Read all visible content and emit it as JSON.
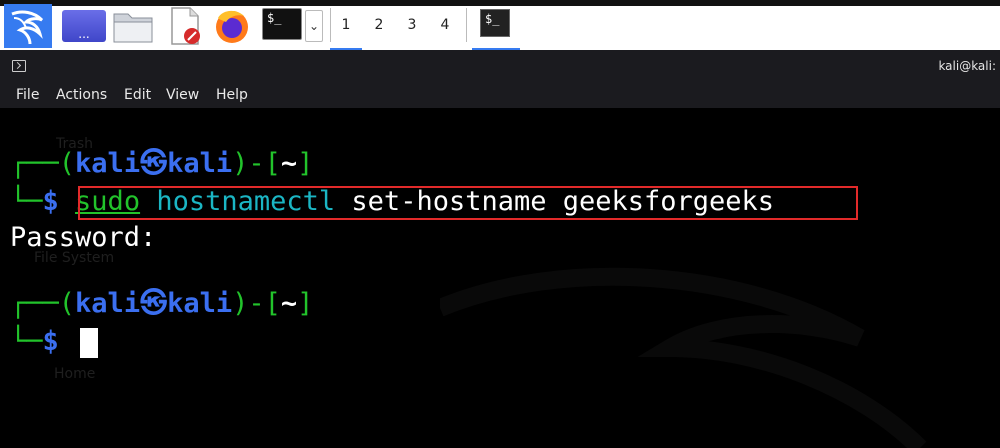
{
  "taskbar": {
    "workspaces": [
      "1",
      "2",
      "3",
      "4"
    ],
    "active_workspace": "1",
    "desk_switch_dots": "...",
    "term_icon_text": "$_",
    "dropdown_glyph": "⌄"
  },
  "window": {
    "title": "kali@kali:"
  },
  "menu": {
    "items": [
      "File",
      "Actions",
      "Edit",
      "View",
      "Help"
    ]
  },
  "desktop": {
    "labels": [
      "Trash",
      "File System",
      "Home"
    ]
  },
  "terminal": {
    "prompt1": {
      "corner": "┌──",
      "open": "(",
      "user": "kali",
      "at": "㉿",
      "host": "kali",
      "close": ")-[",
      "dir": "~",
      "end": "]"
    },
    "line2_corner": "└─",
    "dollar": "$",
    "command_sudo": "sudo",
    "command_prog": "hostnamectl",
    "command_args": "set-hostname geeksforgeeks",
    "output": "Password:",
    "prompt2": {
      "corner": "┌──",
      "open": "(",
      "user": "kali",
      "at": "㉿",
      "host": "kali",
      "close": ")-[",
      "dir": "~",
      "end": "]"
    },
    "line4_corner": "└─",
    "dollar2": "$"
  },
  "colors": {
    "accent": "#367bf0",
    "highlight_box": "#e22a2a",
    "prompt_green": "#22c32b",
    "prompt_blue": "#3b6ff0"
  }
}
